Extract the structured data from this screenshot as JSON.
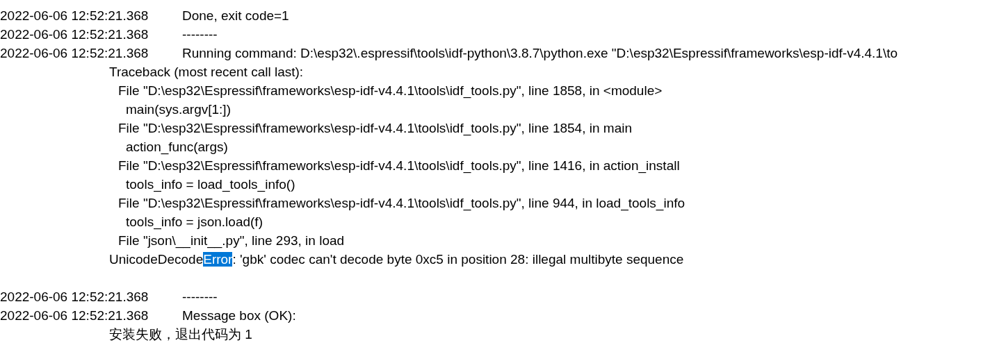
{
  "log": {
    "entries": [
      {
        "timestamp": "2022-06-06 12:52:21.368",
        "message": "Done, exit code=1"
      },
      {
        "timestamp": "2022-06-06 12:52:21.368",
        "message": "--------"
      },
      {
        "timestamp": "2022-06-06 12:52:21.368",
        "message": "Running command: D:\\esp32\\.espressif\\tools\\idf-python\\3.8.7\\python.exe \"D:\\esp32\\Espressif\\frameworks\\esp-idf-v4.4.1\\to",
        "details": [
          {
            "text": "Traceback (most recent call last):",
            "children": [
              {
                "text": "File \"D:\\esp32\\Espressif\\frameworks\\esp-idf-v4.4.1\\tools\\idf_tools.py\", line 1858, in <module>",
                "children": [
                  {
                    "text": "main(sys.argv[1:])"
                  }
                ]
              },
              {
                "text": "File \"D:\\esp32\\Espressif\\frameworks\\esp-idf-v4.4.1\\tools\\idf_tools.py\", line 1854, in main",
                "children": [
                  {
                    "text": "action_func(args)"
                  }
                ]
              },
              {
                "text": "File \"D:\\esp32\\Espressif\\frameworks\\esp-idf-v4.4.1\\tools\\idf_tools.py\", line 1416, in action_install",
                "children": [
                  {
                    "text": "tools_info = load_tools_info()"
                  }
                ]
              },
              {
                "text": "File \"D:\\esp32\\Espressif\\frameworks\\esp-idf-v4.4.1\\tools\\idf_tools.py\", line 944, in load_tools_info",
                "children": [
                  {
                    "text": "tools_info = json.load(f)"
                  }
                ]
              },
              {
                "text": "File \"json\\__init__.py\", line 293, in load"
              }
            ]
          },
          {
            "blank_line_after": true,
            "parts": [
              {
                "text": "UnicodeDecode",
                "selected": false
              },
              {
                "text": "Error",
                "selected": true
              },
              {
                "text": ": 'gbk' codec can't decode byte 0xc5 in position 28: illegal multibyte sequence",
                "selected": false
              }
            ]
          }
        ]
      },
      {
        "timestamp": "2022-06-06 12:52:21.368",
        "message": "--------"
      },
      {
        "timestamp": "2022-06-06 12:52:21.368",
        "message": "Message box (OK):",
        "details": [
          {
            "text": "安装失败，退出代码为 1"
          }
        ]
      }
    ]
  }
}
